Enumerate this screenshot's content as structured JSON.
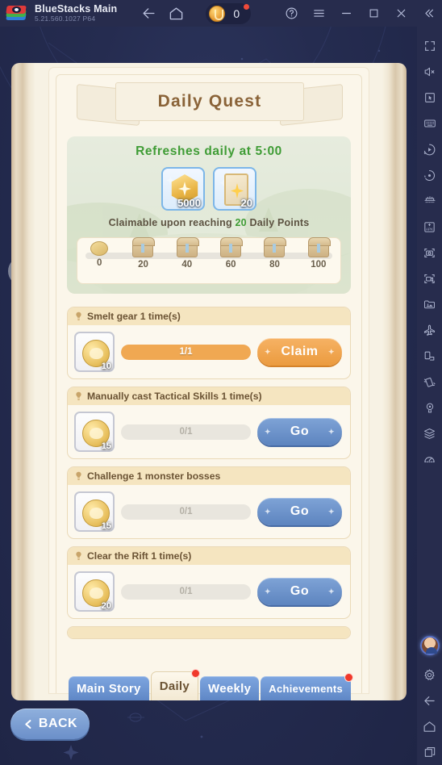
{
  "titlebar": {
    "app_name": "BlueStacks Main",
    "version": "5.21.560.1027  P64",
    "logo_icon": "bluestacks-logo",
    "back_icon": "arrow-left-icon",
    "home_icon": "home-icon",
    "coin_icon": "coin-icon",
    "coin_value": "0",
    "help_icon": "help-circle-icon",
    "menu_icon": "hamburger-menu-icon",
    "minimize_icon": "minimize-icon",
    "maximize_icon": "maximize-icon",
    "close_icon": "close-icon",
    "collapse_icon": "chevron-double-left-icon"
  },
  "game": {
    "banner_title": "Daily Quest",
    "chat_icon": "chat-bubble-icon",
    "header": {
      "refresh_text": "Refreshes daily at 5:00",
      "rewards": [
        {
          "icon": "gem-hex-icon",
          "qty": "5000"
        },
        {
          "icon": "star-card-icon",
          "qty": "20"
        }
      ],
      "claim_note_pre": "Claimable upon reaching ",
      "claim_note_num": "20",
      "claim_note_post": " Daily Points",
      "milestones": [
        {
          "label": "0",
          "icon": "coin-icon"
        },
        {
          "label": "20",
          "icon": "chest-icon"
        },
        {
          "label": "40",
          "icon": "chest-icon"
        },
        {
          "label": "60",
          "icon": "chest-icon"
        },
        {
          "label": "80",
          "icon": "chest-icon"
        },
        {
          "label": "100",
          "icon": "chest-icon"
        }
      ]
    },
    "quests": [
      {
        "title": "Smelt gear 1 time(s)",
        "reward_qty": "10",
        "progress_text": "1/1",
        "progress_pct": 100,
        "button_label": "Claim",
        "button_state": "claim"
      },
      {
        "title": "Manually cast Tactical Skills 1 time(s)",
        "reward_qty": "15",
        "progress_text": "0/1",
        "progress_pct": 0,
        "button_label": "Go",
        "button_state": "go"
      },
      {
        "title": "Challenge 1 monster bosses",
        "reward_qty": "15",
        "progress_text": "0/1",
        "progress_pct": 0,
        "button_label": "Go",
        "button_state": "go"
      },
      {
        "title": "Clear the Rift 1 time(s)",
        "reward_qty": "20",
        "progress_text": "0/1",
        "progress_pct": 0,
        "button_label": "Go",
        "button_state": "go"
      }
    ],
    "tabs": [
      {
        "label": "Main Story",
        "active": false,
        "badge": false
      },
      {
        "label": "Daily",
        "active": true,
        "badge": true
      },
      {
        "label": "Weekly",
        "active": false,
        "badge": false
      },
      {
        "label": "Achievements",
        "active": false,
        "badge": true
      }
    ],
    "back_button": {
      "label": "BACK",
      "icon": "chevron-left-icon"
    }
  },
  "sidebar": {
    "items": [
      {
        "icon": "fullscreen-icon"
      },
      {
        "icon": "mute-speaker-icon"
      },
      {
        "icon": "cursor-pointer-icon"
      },
      {
        "icon": "keyboard-icon"
      },
      {
        "icon": "macro-record-icon"
      },
      {
        "icon": "sync-operations-icon"
      },
      {
        "icon": "multi-instance-icon"
      },
      {
        "icon": "apk-install-icon"
      },
      {
        "icon": "screenshot-icon"
      },
      {
        "icon": "video-record-icon"
      },
      {
        "icon": "media-manager-icon"
      },
      {
        "icon": "eco-mode-icon"
      },
      {
        "icon": "rotate-screen-icon"
      },
      {
        "icon": "shake-icon"
      },
      {
        "icon": "location-pin-icon"
      },
      {
        "icon": "layers-icon"
      },
      {
        "icon": "performance-gauge-icon"
      }
    ],
    "avatar_icon": "user-avatar",
    "settings_icon": "gear-icon",
    "nav_back_icon": "arrow-left-icon",
    "nav_home_icon": "home-icon",
    "nav_recents_icon": "recent-apps-icon"
  },
  "colors": {
    "accent_orange": "#f0a852",
    "accent_blue": "#5d84bf",
    "green_text": "#3f9c35",
    "page_cream": "#fbf6ea",
    "banner_brown": "#8a6338",
    "chrome_dark": "#272c4d"
  }
}
